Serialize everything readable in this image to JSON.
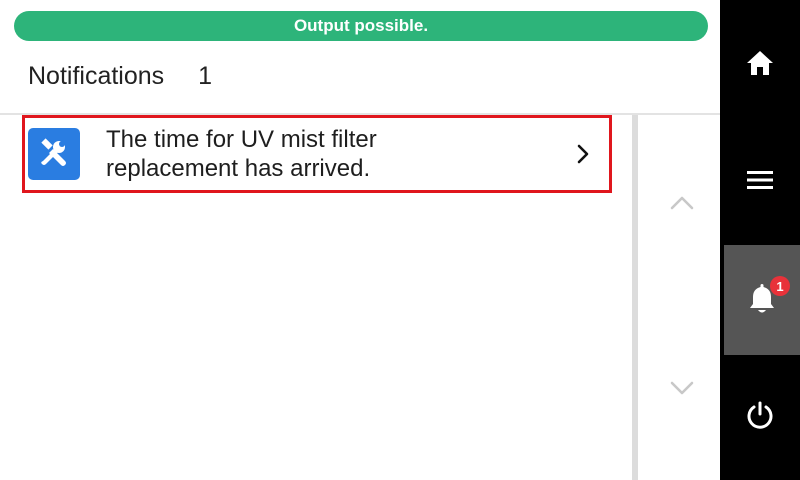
{
  "status": {
    "text": "Output possible.",
    "color": "#2db47a"
  },
  "header": {
    "title": "Notifications",
    "count": "1"
  },
  "notifications": [
    {
      "icon": "tools-icon",
      "message_line1": "The time for UV mist filter",
      "message_line2": "replacement has arrived.",
      "selected": true
    }
  ],
  "scroll": {
    "up_icon": "chevron-up-icon",
    "down_icon": "chevron-down-icon"
  },
  "nav": {
    "items": [
      {
        "icon": "home-icon"
      },
      {
        "icon": "menu-icon"
      },
      {
        "icon": "bell-icon",
        "badge": "1",
        "active": true
      },
      {
        "icon": "power-icon"
      }
    ]
  },
  "colors": {
    "accent_blue": "#2a7de1",
    "highlight_red": "#e0161d",
    "badge_red": "#e8323a",
    "nav_bg": "#000000",
    "nav_active_bg": "#555555"
  }
}
